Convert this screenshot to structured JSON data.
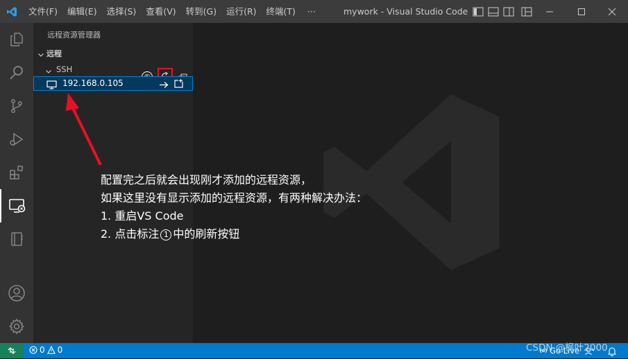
{
  "titlebar": {
    "menus": [
      "文件(F)",
      "编辑(E)",
      "选择(S)",
      "查看(V)",
      "转到(G)",
      "运行(R)",
      "终端(T)",
      "···"
    ],
    "window_title": "mywork - Visual Studio Code [管..."
  },
  "activity_bar": {
    "icons": [
      "explorer-icon",
      "search-icon",
      "source-control-icon",
      "run-debug-icon",
      "extensions-icon",
      "remote-explorer-icon",
      "notebook-icon",
      "account-icon",
      "settings-gear-icon"
    ],
    "active": "remote-explorer-icon"
  },
  "sidebar": {
    "title": "远程资源管理器",
    "section_label": "远程",
    "callout_number": "①",
    "group_label": "SSH",
    "host": "192.168.0.105"
  },
  "annotation": {
    "line1": "配置完之后就会出现刚才添加的远程资源，",
    "line2": "如果这里没有显示添加的远程资源，有两种解决办法：",
    "line3": "1. 重启VS Code",
    "line4_pre": "2. 点击标注",
    "line4_circle": "1",
    "line4_post": "中的刷新按钮"
  },
  "statusbar": {
    "errors": "0",
    "warnings": "0",
    "go_live": "Go Live",
    "watermark": "CSDN @枫叶2000"
  },
  "colors": {
    "statusbar": "#007acc",
    "remote_indicator": "#16825d",
    "highlight_border": "#e81123",
    "selection": "#04395e"
  }
}
